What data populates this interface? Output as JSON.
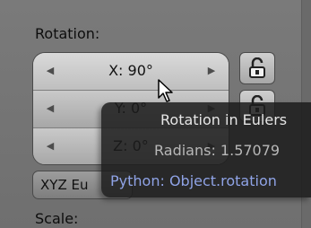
{
  "rotation": {
    "label": "Rotation:",
    "fields": [
      {
        "label": "X:",
        "value": "90°"
      },
      {
        "label": "Y:",
        "value": "0°"
      },
      {
        "label": "Z:",
        "value": "0°"
      }
    ],
    "mode_dropdown": "XYZ Eu"
  },
  "scale": {
    "label": "Scale:"
  },
  "tooltip": {
    "title": "Rotation in Eulers",
    "radians": "Radians: 1.57079",
    "python": "Python: Object.rotation"
  },
  "icons": {
    "lock": "lock-open-icon",
    "cursor": "mouse-pointer-icon",
    "decrement": "chevron-left-icon",
    "increment": "chevron-right-icon"
  },
  "colors": {
    "tooltip_bg": "#1c1c1c",
    "tooltip_python": "#8fa3e6",
    "panel_bg": "#737373",
    "field_bg": "#c9c9c9"
  }
}
